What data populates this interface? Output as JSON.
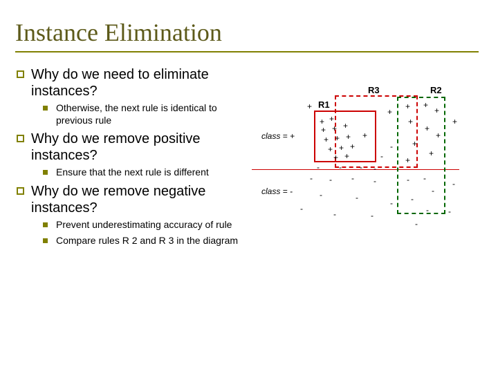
{
  "title": "Instance Elimination",
  "bullets": {
    "b1": "Why do we need to eliminate instances?",
    "b1a": "Otherwise, the next rule is identical to previous rule",
    "b2": "Why do we remove positive instances?",
    "b2a": "Ensure that the next rule is different",
    "b3": "Why do we remove negative instances?",
    "b3a": "Prevent underestimating accuracy of rule",
    "b3b": "Compare rules R 2 and R 3 in the diagram"
  },
  "diagram": {
    "r1": "R1",
    "r2": "R2",
    "r3": "R3",
    "class_pos": "class = +",
    "class_neg": "class = -",
    "plus": "+",
    "minus": "-"
  }
}
